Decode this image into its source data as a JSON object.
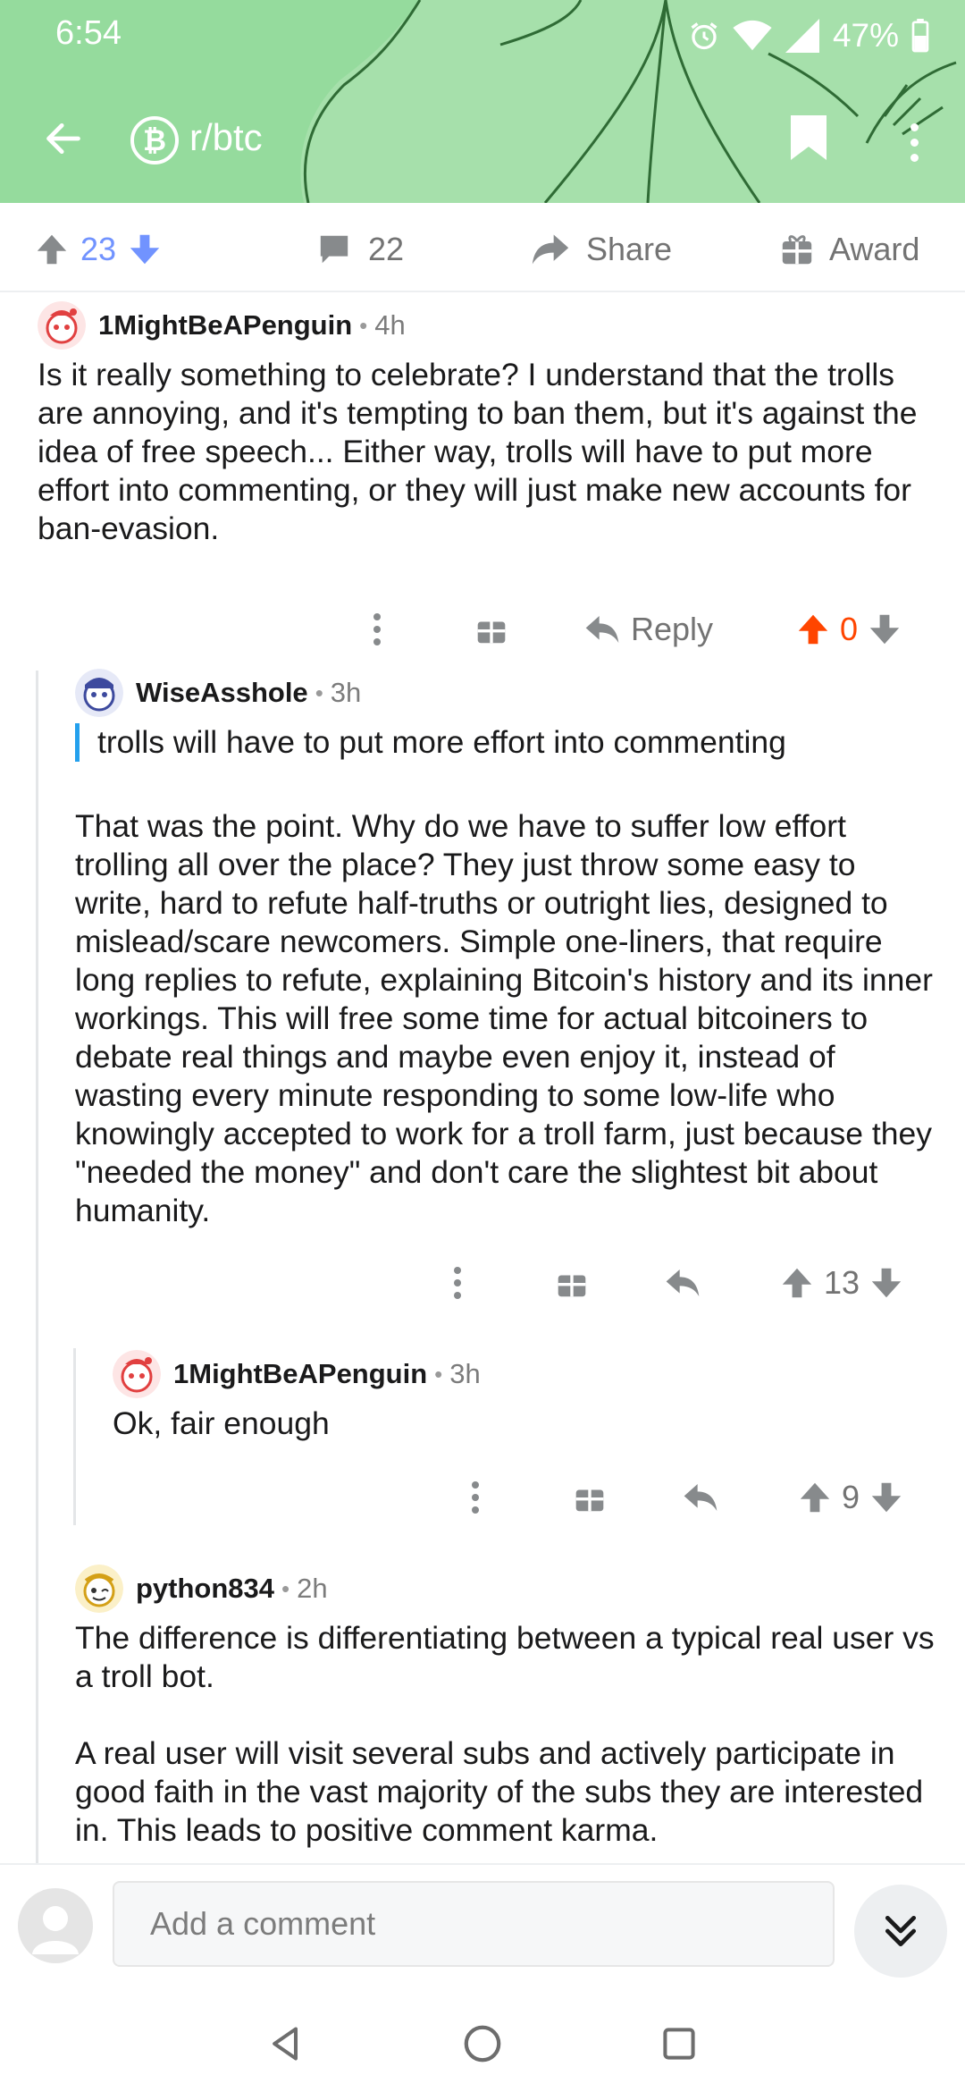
{
  "status_bar": {
    "time": "6:54",
    "battery": "47%"
  },
  "header": {
    "subreddit": "r/btc",
    "subreddit_icon": "bitcoin-icon",
    "background_color": "#95db9d"
  },
  "post_actions": {
    "score": "23",
    "comments": "22",
    "share_label": "Share",
    "award_label": "Award"
  },
  "comments": [
    {
      "author": "1MightBeAPenguin",
      "time": "4h",
      "body": [
        "Is it really something to celebrate? I understand that the trolls are annoying, and it's tempting to ban them, but it's against the idea of free speech... Either way, trolls will have to put more effort into commenting, or they will just make new accounts for ban-evasion."
      ],
      "reply_label": "Reply",
      "score": "0",
      "upvoted": true
    },
    {
      "author": "WiseAsshole",
      "time": "3h",
      "quote": "trolls will have to put more effort into commenting",
      "body": [
        "That was the point. Why do we have to suffer low effort trolling all over the place? They just throw some easy to write, hard to refute half-truths or outright lies, designed to mislead/scare newcomers. Simple one-liners, that require long replies to refute, explaining Bitcoin's history and its inner workings. This will free some time for actual bitcoiners to debate real things and maybe even enjoy it, instead of wasting every minute responding to some low-life who knowingly accepted to work for a troll farm, just because they \"needed the money\" and don't care the slightest bit about humanity."
      ],
      "score": "13"
    },
    {
      "author": "1MightBeAPenguin",
      "time": "3h",
      "body": [
        "Ok, fair enough"
      ],
      "score": "9"
    },
    {
      "author": "python834",
      "time": "2h",
      "body": [
        "The difference is differentiating between a typical real user vs a troll bot.",
        "A real user will visit several subs and actively participate in good faith in the vast majority of the subs they are interested in. This leads to positive comment karma."
      ]
    }
  ],
  "composer": {
    "placeholder": "Add a comment"
  },
  "colors": {
    "upvote_active": "#ff4500",
    "score_blue": "#7193ff",
    "quote_bar": "#24a0ed",
    "icon_gray": "#878a8c"
  }
}
